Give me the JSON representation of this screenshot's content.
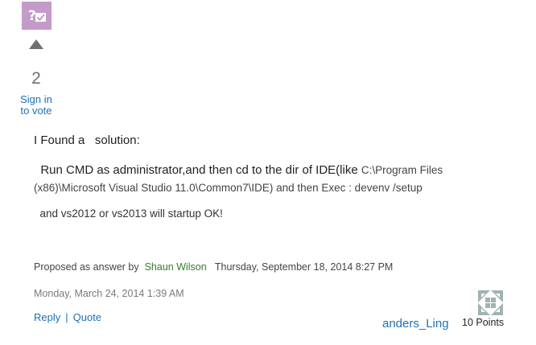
{
  "badge": {
    "icon": "question-answered-icon",
    "color": "#c49ac9"
  },
  "vote": {
    "count": "2",
    "sign_in_line1": "Sign in",
    "sign_in_line2": "to vote"
  },
  "post": {
    "intro": "I Found a   solution:",
    "step1_lead": "  Run CMD as administrator,and then cd to the dir of IDE(like ",
    "step1_path": "C:\\Program Files (x86)\\Microsoft Visual Studio 11.0\\Common7\\IDE) and then Exec : devenv /setup",
    "step2": "  and vs2012 or vs2013 will startup OK!"
  },
  "proposed": {
    "prefix": "Proposed as answer by  ",
    "proposer": "Shaun Wilson",
    "timestamp": "   Thursday, September 18, 2014 8:27 PM"
  },
  "post_date": "Monday, March 24, 2014 1:39 AM",
  "actions": {
    "reply": "Reply",
    "separator": "|",
    "quote": "Quote"
  },
  "author": {
    "name": "anders_Ling",
    "points": "10 Points",
    "avatar_icon": "identicon-avatar-icon"
  },
  "colors": {
    "link": "#1f6fb7",
    "proposer": "#3a7a2e",
    "muted": "#7a7a7a"
  }
}
